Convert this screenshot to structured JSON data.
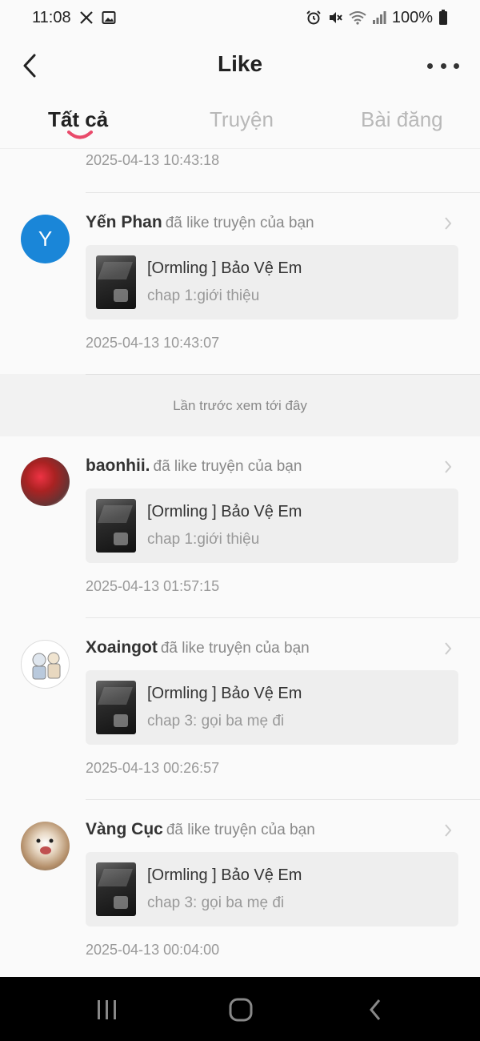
{
  "status": {
    "time": "11:08",
    "battery": "100%",
    "left_icons": [
      "x-app-icon",
      "image-icon"
    ],
    "right_icons": [
      "alarm-icon",
      "mute-icon",
      "wifi-icon",
      "signal-icon",
      "battery-icon"
    ]
  },
  "header": {
    "title": "Like"
  },
  "tabs": [
    {
      "label": "Tất cả",
      "active": true
    },
    {
      "label": "Truyện",
      "active": false
    },
    {
      "label": "Bài đăng",
      "active": false
    }
  ],
  "top_partial": {
    "time": "2025-04-13 10:43:18"
  },
  "items": [
    {
      "user": "Yến Phan",
      "action": "đã like truyện của bạn",
      "story": "[Ormling ] Bảo Vệ Em",
      "chapter": "chap 1:giới thiệu",
      "time": "2025-04-13 10:43:07",
      "avatar_letter": "Y"
    },
    {
      "user": "baonhii.",
      "action": "đã like truyện của bạn",
      "story": "[Ormling ] Bảo Vệ Em",
      "chapter": "chap 1:giới thiệu",
      "time": "2025-04-13 01:57:15"
    },
    {
      "user": "Xoaingot",
      "action": "đã like truyện của bạn",
      "story": "[Ormling ] Bảo Vệ Em",
      "chapter": "chap 3: gọi ba mẹ đi",
      "time": "2025-04-13 00:26:57"
    },
    {
      "user": "Vàng Cục",
      "action": "đã like truyện của bạn",
      "story": "[Ormling ] Bảo Vệ Em",
      "chapter": "chap 3: gọi ba mẹ đi",
      "time": "2025-04-13 00:04:00"
    }
  ],
  "separator": {
    "text": "Lần trước xem tới đây"
  },
  "colors": {
    "accent": "#e94a6a",
    "avatar_blue": "#1a86d8",
    "background": "#fafafa",
    "card": "#eeeeee"
  }
}
